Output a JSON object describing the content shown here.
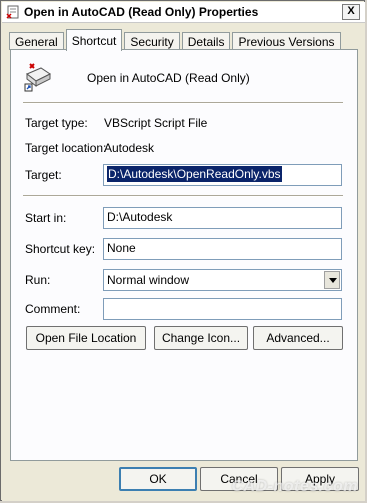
{
  "window": {
    "title": "Open in AutoCAD (Read Only) Properties",
    "close_glyph": "X",
    "app_icon": "script-file-icon"
  },
  "tabs": [
    {
      "label": "General",
      "active": false
    },
    {
      "label": "Shortcut",
      "active": true
    },
    {
      "label": "Security",
      "active": false
    },
    {
      "label": "Details",
      "active": false
    },
    {
      "label": "Previous Versions",
      "active": false
    }
  ],
  "shortcut": {
    "name": "Open in AutoCAD (Read Only)",
    "icon": "shortcut-script-icon",
    "target_type_label": "Target type:",
    "target_type_value": "VBScript Script File",
    "target_location_label": "Target location:",
    "target_location_value": "Autodesk",
    "target_label": "Target:",
    "target_value": "D:\\Autodesk\\OpenReadOnly.vbs",
    "start_in_label": "Start in:",
    "start_in_value": "D:\\Autodesk",
    "shortcut_key_label": "Shortcut key:",
    "shortcut_key_value": "None",
    "run_label": "Run:",
    "run_value": "Normal window",
    "comment_label": "Comment:",
    "comment_value": "",
    "open_file_location_label": "Open File Location",
    "change_icon_label": "Change Icon...",
    "advanced_label": "Advanced..."
  },
  "footer": {
    "ok_label": "OK",
    "cancel_label": "Cancel",
    "apply_label": "Apply"
  },
  "watermark": "CAD-notes.com",
  "colors": {
    "selection_bg": "#0a246a",
    "field_border": "#7f9db9",
    "default_button_border": "#3c7fb1"
  }
}
